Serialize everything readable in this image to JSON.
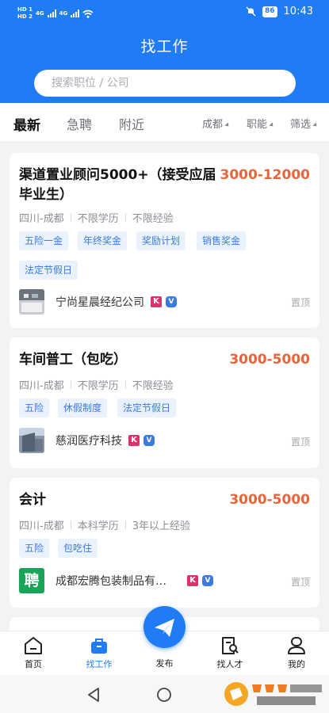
{
  "status_bar": {
    "sim1": "HD 1",
    "sim2": "HD 2",
    "net1": "4G",
    "net2": "4G",
    "battery": "86",
    "time": "10:43"
  },
  "header": {
    "title": "找工作",
    "search_placeholder": "搜索职位 / 公司"
  },
  "tabs": [
    "最新",
    "急聘",
    "附近"
  ],
  "filters": [
    "成都",
    "职能",
    "筛选"
  ],
  "jobs": [
    {
      "title": "渠道置业顾问5000+（接受应届毕业生）",
      "salary": "3000-12000",
      "location": "四川-成都",
      "education": "不限学历",
      "experience": "不限经验",
      "tags": [
        "五险一金",
        "年终奖金",
        "奖励计划",
        "销售奖金",
        "法定节假日"
      ],
      "company": "宁尚星晨经纪公司",
      "pin": "置顶"
    },
    {
      "title": "车间普工（包吃）",
      "salary": "3000-5000",
      "location": "四川-成都",
      "education": "不限学历",
      "experience": "不限经验",
      "tags": [
        "五险",
        "休假制度",
        "法定节假日"
      ],
      "company": "慈润医疗科技",
      "pin": "置顶"
    },
    {
      "title": "会计",
      "salary": "3000-5000",
      "location": "四川-成都",
      "education": "本科学历",
      "experience": "3年以上经验",
      "tags": [
        "五险",
        "包吃住"
      ],
      "company": "成都宏腾包装制品有…",
      "logo_text": "聘",
      "pin": "置顶"
    }
  ],
  "badges": {
    "k": "K",
    "v": "V"
  },
  "bottom_tabs": {
    "home": "首页",
    "jobs": "找工作",
    "publish": "发布",
    "talent": "找人才",
    "mine": "我的"
  },
  "colors": {
    "primary": "#1f7cf5",
    "salary": "#e8643a",
    "tag_bg": "#eaf2fe",
    "tag_text": "#3b7be0"
  }
}
